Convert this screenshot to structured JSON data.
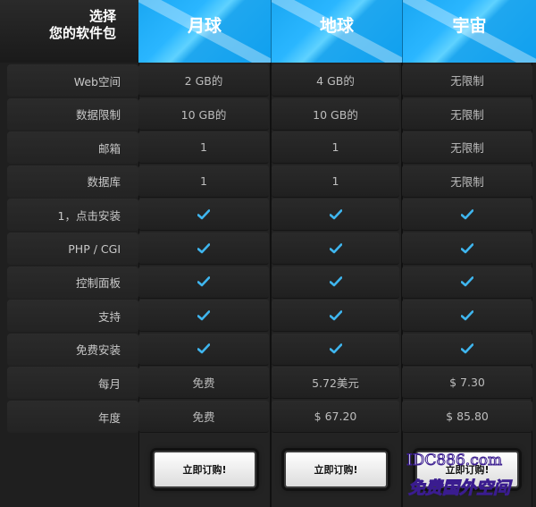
{
  "header": {
    "corner_line1": "选择",
    "corner_line2": "您的软件包",
    "plans": [
      "月球",
      "地球",
      "宇宙"
    ]
  },
  "rows": [
    {
      "label": "Web空间",
      "values": [
        "2 GB的",
        "4 GB的",
        "无限制"
      ]
    },
    {
      "label": "数据限制",
      "values": [
        "10 GB的",
        "10 GB的",
        "无限制"
      ]
    },
    {
      "label": "邮箱",
      "values": [
        "1",
        "1",
        "无限制"
      ]
    },
    {
      "label": "数据库",
      "values": [
        "1",
        "1",
        "无限制"
      ]
    },
    {
      "label": "1，点击安装",
      "values": [
        "check",
        "check",
        "check"
      ]
    },
    {
      "label": "PHP / CGI",
      "values": [
        "check",
        "check",
        "check"
      ]
    },
    {
      "label": "控制面板",
      "values": [
        "check",
        "check",
        "check"
      ]
    },
    {
      "label": "支持",
      "values": [
        "check",
        "check",
        "check"
      ]
    },
    {
      "label": "免费安装",
      "values": [
        "check",
        "check",
        "check"
      ]
    },
    {
      "label": "每月",
      "values": [
        "免费",
        "5.72美元",
        "$ 7.30"
      ]
    },
    {
      "label": "年度",
      "values": [
        "免费",
        "$ 67.20",
        "$ 85.80"
      ]
    }
  ],
  "order_button_label": "立即订购!",
  "watermark": {
    "line1": "IDC886.com",
    "line2": "免费国外空间"
  },
  "colors": {
    "accent": "#1aa7f2",
    "check": "#3fb6ef"
  }
}
